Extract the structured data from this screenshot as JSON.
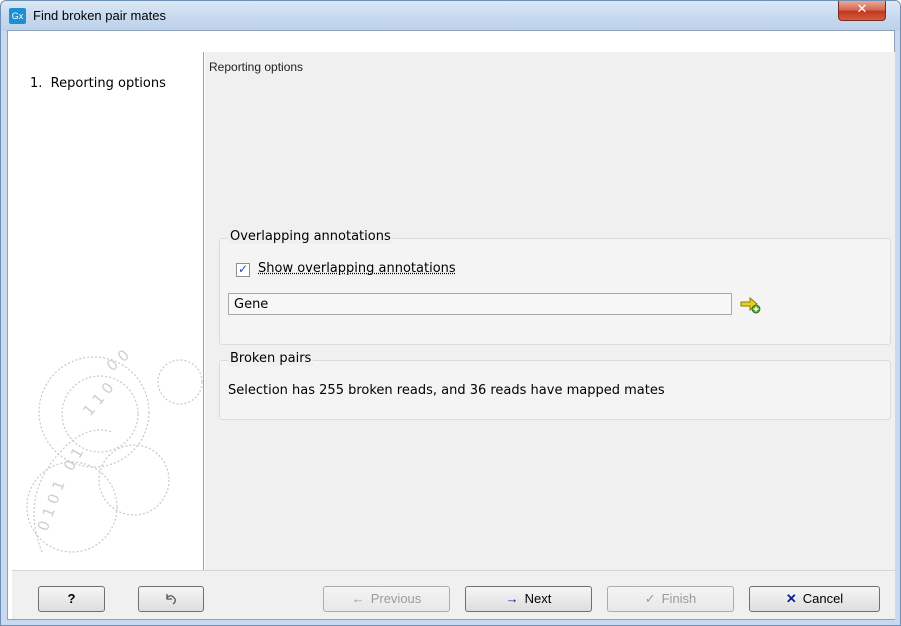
{
  "window": {
    "title": "Find broken pair mates",
    "app_icon_text": "Gx",
    "close_glyph": "✕"
  },
  "sidebar": {
    "steps": [
      {
        "number": "1.",
        "label": "Reporting options"
      }
    ]
  },
  "main": {
    "heading": "Reporting options",
    "overlapping": {
      "legend": "Overlapping annotations",
      "checkbox_label": "Show overlapping annotations",
      "checked": true,
      "annotation_field_value": "Gene"
    },
    "broken_pairs": {
      "legend": "Broken pairs",
      "message": "Selection has 255 broken reads, and 36 reads have mapped mates"
    }
  },
  "footer": {
    "help_label": "?",
    "previous_label": "Previous",
    "next_label": "Next",
    "finish_label": "Finish",
    "cancel_label": "Cancel",
    "previous_glyph": "←",
    "next_glyph": "→",
    "finish_glyph": "✓",
    "cancel_glyph": "✕"
  },
  "colors": {
    "titlebar": "#c9daef",
    "close_button": "#c0391f",
    "next_arrow": "#0a1f8f",
    "cancel_x": "#0a1f8f",
    "add_icon": "#e8d21c"
  },
  "icons": {
    "app": "app-logo-icon",
    "close": "close-icon",
    "reset": "undo-arrow-icon",
    "add_annotation": "add-annotation-icon"
  }
}
